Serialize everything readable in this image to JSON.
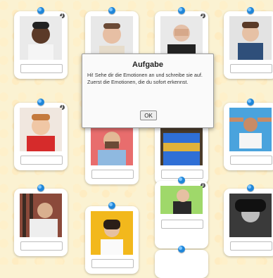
{
  "dialog": {
    "title": "Aufgabe",
    "message": "Hi! Sehe dir die Emotionen an und schreibe sie auf. Zuerst die Emotionen, die du sofort erkennst.",
    "ok_label": "OK"
  },
  "colors": {
    "background": "#fbf2d2",
    "pin": "#1f86d9"
  }
}
